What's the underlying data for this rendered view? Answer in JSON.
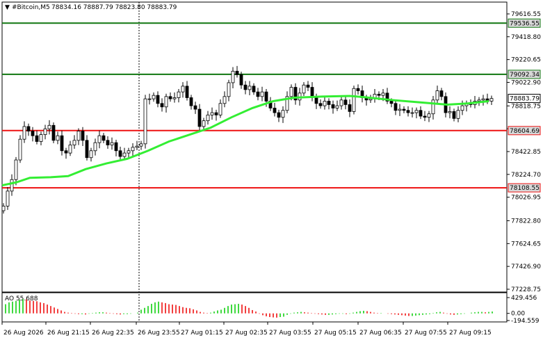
{
  "window": {
    "title": "#Bitcoin,M5",
    "ohlc": "78834.16 78887.79 78823.80 78883.79",
    "indicator_title": "AO 55.688"
  },
  "colors": {
    "background": "#ffffff",
    "candles": "#000000",
    "ma_line": "#33ee33",
    "resistance": "#117711",
    "support": "#ee1111",
    "ao_up": "#00cc00",
    "ao_down": "#ee0000",
    "price_tag_bg": "#d8d8d8"
  },
  "chart_data": {
    "type": "candlestick",
    "y_ticks": [
      "79616.55",
      "79418.80",
      "79220.65",
      "79022.90",
      "78818.75",
      "78620.60",
      "78422.85",
      "78224.70",
      "78026.95",
      "77822.80",
      "77624.65",
      "77426.90",
      "77228.75"
    ],
    "y_range": [
      77228.75,
      79616.55
    ],
    "x_ticks": [
      "26 Aug 2026",
      "26 Aug 21:15",
      "26 Aug 22:35",
      "26 Aug 23:55",
      "27 Aug 01:15",
      "27 Aug 02:35",
      "27 Aug 03:55",
      "27 Aug 05:15",
      "27 Aug 06:35",
      "27 Aug 07:55",
      "27 Aug 09:15"
    ],
    "levels": [
      {
        "label": "79536.55",
        "value": 79536.55,
        "color": "#117711"
      },
      {
        "label": "79092.34",
        "value": 79092.34,
        "color": "#117711"
      },
      {
        "label": "78604.69",
        "value": 78604.69,
        "color": "#ee1111"
      },
      {
        "label": "78108.55",
        "value": 78108.55,
        "color": "#ee1111"
      }
    ],
    "current_price": {
      "label": "78883.79",
      "value": 78883.79
    },
    "ma_series": [
      [
        0,
        78130
      ],
      [
        20,
        78155
      ],
      [
        40,
        78195
      ],
      [
        70,
        78200
      ],
      [
        95,
        78210
      ],
      [
        120,
        78270
      ],
      [
        150,
        78320
      ],
      [
        180,
        78360
      ],
      [
        210,
        78430
      ],
      [
        240,
        78510
      ],
      [
        270,
        78570
      ],
      [
        300,
        78630
      ],
      [
        330,
        78720
      ],
      [
        360,
        78800
      ],
      [
        390,
        78860
      ],
      [
        420,
        78890
      ],
      [
        460,
        78900
      ],
      [
        500,
        78905
      ],
      [
        520,
        78895
      ],
      [
        560,
        78870
      ],
      [
        600,
        78850
      ],
      [
        640,
        78830
      ],
      [
        670,
        78840
      ],
      [
        700,
        78860
      ]
    ],
    "price_series": [
      [
        2,
        77950
      ],
      [
        8,
        78080
      ],
      [
        14,
        78180
      ],
      [
        20,
        78350
      ],
      [
        26,
        78530
      ],
      [
        32,
        78640
      ],
      [
        38,
        78600
      ],
      [
        44,
        78560
      ],
      [
        50,
        78510
      ],
      [
        56,
        78570
      ],
      [
        62,
        78620
      ],
      [
        68,
        78650
      ],
      [
        74,
        78520
      ],
      [
        80,
        78560
      ],
      [
        86,
        78430
      ],
      [
        92,
        78410
      ],
      [
        98,
        78480
      ],
      [
        104,
        78520
      ],
      [
        110,
        78600
      ],
      [
        116,
        78520
      ],
      [
        122,
        78370
      ],
      [
        128,
        78430
      ],
      [
        134,
        78500
      ],
      [
        140,
        78560
      ],
      [
        146,
        78520
      ],
      [
        152,
        78480
      ],
      [
        158,
        78500
      ],
      [
        164,
        78430
      ],
      [
        170,
        78380
      ],
      [
        176,
        78410
      ],
      [
        182,
        78430
      ],
      [
        188,
        78460
      ],
      [
        194,
        78470
      ],
      [
        200,
        78490
      ],
      [
        206,
        78880
      ],
      [
        212,
        78880
      ],
      [
        218,
        78910
      ],
      [
        224,
        78840
      ],
      [
        230,
        78810
      ],
      [
        236,
        78900
      ],
      [
        242,
        78880
      ],
      [
        248,
        78890
      ],
      [
        254,
        78940
      ],
      [
        260,
        78990
      ],
      [
        266,
        78890
      ],
      [
        272,
        78820
      ],
      [
        278,
        78790
      ],
      [
        284,
        78640
      ],
      [
        290,
        78690
      ],
      [
        296,
        78740
      ],
      [
        302,
        78760
      ],
      [
        308,
        78740
      ],
      [
        314,
        78840
      ],
      [
        320,
        78900
      ],
      [
        326,
        79020
      ],
      [
        332,
        79120
      ],
      [
        338,
        79090
      ],
      [
        344,
        79000
      ],
      [
        350,
        78960
      ],
      [
        356,
        78990
      ],
      [
        362,
        78940
      ],
      [
        368,
        78900
      ],
      [
        374,
        78940
      ],
      [
        380,
        78860
      ],
      [
        386,
        78800
      ],
      [
        392,
        78760
      ],
      [
        398,
        78720
      ],
      [
        404,
        78780
      ],
      [
        410,
        78900
      ],
      [
        416,
        78980
      ],
      [
        422,
        78870
      ],
      [
        428,
        78930
      ],
      [
        434,
        79000
      ],
      [
        440,
        78980
      ],
      [
        446,
        78900
      ],
      [
        452,
        78840
      ],
      [
        458,
        78820
      ],
      [
        464,
        78860
      ],
      [
        470,
        78830
      ],
      [
        476,
        78800
      ],
      [
        482,
        78820
      ],
      [
        488,
        78870
      ],
      [
        494,
        78830
      ],
      [
        500,
        78770
      ],
      [
        506,
        78970
      ],
      [
        512,
        78950
      ],
      [
        518,
        78890
      ],
      [
        524,
        78870
      ],
      [
        530,
        78880
      ],
      [
        536,
        78920
      ],
      [
        542,
        78910
      ],
      [
        548,
        78930
      ],
      [
        554,
        78860
      ],
      [
        560,
        78840
      ],
      [
        566,
        78780
      ],
      [
        572,
        78790
      ],
      [
        578,
        78780
      ],
      [
        584,
        78760
      ],
      [
        590,
        78760
      ],
      [
        596,
        78780
      ],
      [
        602,
        78730
      ],
      [
        608,
        78720
      ],
      [
        614,
        78750
      ],
      [
        620,
        78870
      ],
      [
        626,
        78950
      ],
      [
        632,
        78900
      ],
      [
        638,
        78760
      ],
      [
        644,
        78770
      ],
      [
        650,
        78710
      ],
      [
        656,
        78780
      ],
      [
        662,
        78820
      ],
      [
        668,
        78840
      ],
      [
        674,
        78830
      ],
      [
        680,
        78860
      ],
      [
        686,
        78870
      ],
      [
        692,
        78880
      ],
      [
        698,
        78860
      ],
      [
        704,
        78883
      ]
    ],
    "ao": {
      "ticks": [
        "429.456",
        "0.00",
        "-194.559"
      ],
      "range": [
        -194.559,
        429.456
      ],
      "series": [
        [
          5,
          250
        ],
        [
          10,
          300
        ],
        [
          15,
          320
        ],
        [
          20,
          340
        ],
        [
          25,
          370
        ],
        [
          30,
          390
        ],
        [
          35,
          380
        ],
        [
          40,
          350
        ],
        [
          45,
          340
        ],
        [
          50,
          330
        ],
        [
          55,
          300
        ],
        [
          60,
          280
        ],
        [
          65,
          240
        ],
        [
          70,
          200
        ],
        [
          75,
          160
        ],
        [
          80,
          120
        ],
        [
          85,
          80
        ],
        [
          90,
          40
        ],
        [
          95,
          20
        ],
        [
          100,
          10
        ],
        [
          105,
          -10
        ],
        [
          110,
          -20
        ],
        [
          115,
          -20
        ],
        [
          120,
          -30
        ],
        [
          125,
          -10
        ],
        [
          130,
          10
        ],
        [
          135,
          20
        ],
        [
          140,
          30
        ],
        [
          145,
          30
        ],
        [
          150,
          20
        ],
        [
          155,
          10
        ],
        [
          160,
          -10
        ],
        [
          165,
          -20
        ],
        [
          170,
          -30
        ],
        [
          175,
          -20
        ],
        [
          180,
          -20
        ],
        [
          185,
          -10
        ],
        [
          190,
          0
        ],
        [
          195,
          20
        ],
        [
          200,
          100
        ],
        [
          205,
          150
        ],
        [
          210,
          200
        ],
        [
          215,
          260
        ],
        [
          220,
          300
        ],
        [
          225,
          320
        ],
        [
          230,
          300
        ],
        [
          235,
          280
        ],
        [
          240,
          250
        ],
        [
          245,
          240
        ],
        [
          250,
          230
        ],
        [
          255,
          200
        ],
        [
          260,
          170
        ],
        [
          265,
          150
        ],
        [
          270,
          140
        ],
        [
          275,
          110
        ],
        [
          280,
          80
        ],
        [
          285,
          40
        ],
        [
          290,
          20
        ],
        [
          295,
          10
        ],
        [
          300,
          20
        ],
        [
          305,
          50
        ],
        [
          310,
          80
        ],
        [
          315,
          100
        ],
        [
          320,
          150
        ],
        [
          325,
          200
        ],
        [
          330,
          240
        ],
        [
          335,
          250
        ],
        [
          340,
          260
        ],
        [
          345,
          240
        ],
        [
          350,
          200
        ],
        [
          355,
          150
        ],
        [
          360,
          90
        ],
        [
          365,
          50
        ],
        [
          370,
          -10
        ],
        [
          375,
          -50
        ],
        [
          380,
          -80
        ],
        [
          385,
          -100
        ],
        [
          390,
          -110
        ],
        [
          395,
          -115
        ],
        [
          400,
          -100
        ],
        [
          405,
          -90
        ],
        [
          410,
          -40
        ],
        [
          415,
          -10
        ],
        [
          420,
          20
        ],
        [
          425,
          30
        ],
        [
          430,
          40
        ],
        [
          435,
          30
        ],
        [
          440,
          20
        ],
        [
          445,
          10
        ],
        [
          450,
          -10
        ],
        [
          455,
          -20
        ],
        [
          460,
          -30
        ],
        [
          465,
          -40
        ],
        [
          470,
          -40
        ],
        [
          475,
          -30
        ],
        [
          480,
          -20
        ],
        [
          485,
          -10
        ],
        [
          490,
          -10
        ],
        [
          495,
          -20
        ],
        [
          500,
          -10
        ],
        [
          505,
          20
        ],
        [
          510,
          40
        ],
        [
          515,
          60
        ],
        [
          520,
          70
        ],
        [
          525,
          60
        ],
        [
          530,
          40
        ],
        [
          535,
          20
        ],
        [
          540,
          10
        ],
        [
          545,
          10
        ],
        [
          550,
          0
        ],
        [
          555,
          -10
        ],
        [
          560,
          -20
        ],
        [
          565,
          -30
        ],
        [
          570,
          -40
        ],
        [
          575,
          -50
        ],
        [
          580,
          -60
        ],
        [
          585,
          -70
        ],
        [
          590,
          -70
        ],
        [
          595,
          -60
        ],
        [
          600,
          -50
        ],
        [
          605,
          -40
        ],
        [
          610,
          -30
        ],
        [
          615,
          -20
        ],
        [
          620,
          10
        ],
        [
          625,
          30
        ],
        [
          630,
          40
        ],
        [
          635,
          20
        ],
        [
          640,
          -10
        ],
        [
          645,
          -30
        ],
        [
          650,
          -40
        ],
        [
          655,
          -30
        ],
        [
          660,
          -20
        ],
        [
          665,
          -10
        ],
        [
          670,
          0
        ],
        [
          675,
          20
        ],
        [
          680,
          30
        ],
        [
          685,
          40
        ],
        [
          690,
          40
        ],
        [
          695,
          30
        ],
        [
          700,
          40
        ],
        [
          705,
          50
        ]
      ]
    }
  }
}
